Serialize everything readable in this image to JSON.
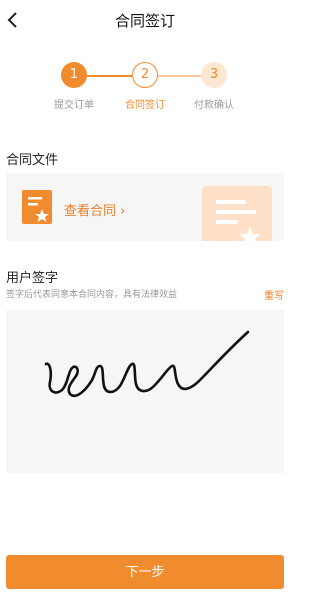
{
  "nav": {
    "title": "合同签订",
    "back_icon": "chevron-left-icon"
  },
  "steps": [
    {
      "number": "1",
      "label": "提交订单",
      "state": "done"
    },
    {
      "number": "2",
      "label": "合同签订",
      "state": "current"
    },
    {
      "number": "3",
      "label": "付款确认",
      "state": "pending"
    }
  ],
  "contract": {
    "section_title": "合同文件",
    "view_label": "查看合同 ›",
    "icon": "document-star-icon"
  },
  "signature": {
    "section_title": "用户签字",
    "hint": "签字后代表同意本合同内容，具有法律效益",
    "rewrite_label": "重写"
  },
  "footer": {
    "next_label": "下一步"
  },
  "colors": {
    "accent": "#f08c2e",
    "accent_light": "#fde6d2",
    "panel": "#f6f6f6"
  }
}
